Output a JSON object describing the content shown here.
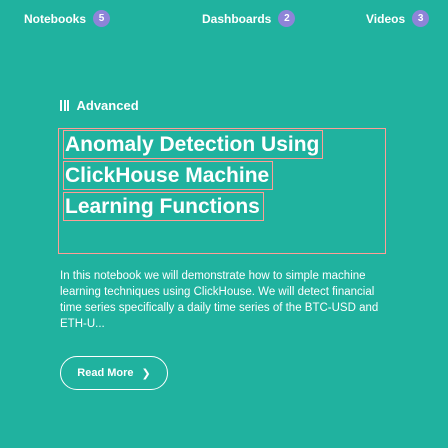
{
  "nav": {
    "items": [
      {
        "label": "Notebooks",
        "count": "5"
      },
      {
        "label": "Dashboards",
        "count": "2"
      },
      {
        "label": "Videos",
        "count": "3"
      }
    ]
  },
  "post": {
    "category": "Advanced",
    "category_icon": "bar-chart-icon",
    "title_lines": [
      "Anomaly Detection Using",
      "ClickHouse Machine",
      "Learning Functions"
    ],
    "description": "In this notebook we will demonstrate how to simple machine learning techniques using ClickHouse. We will detect financial time series specifically a daily time series of the BTC-USD and ETH-U...",
    "read_more_label": "Read More",
    "read_more_icon": "chevron-right-icon"
  },
  "colors": {
    "background": "#20b29f",
    "badge": "#8e84d8",
    "highlight_border": "#ff9d96",
    "text": "#ffffff"
  }
}
